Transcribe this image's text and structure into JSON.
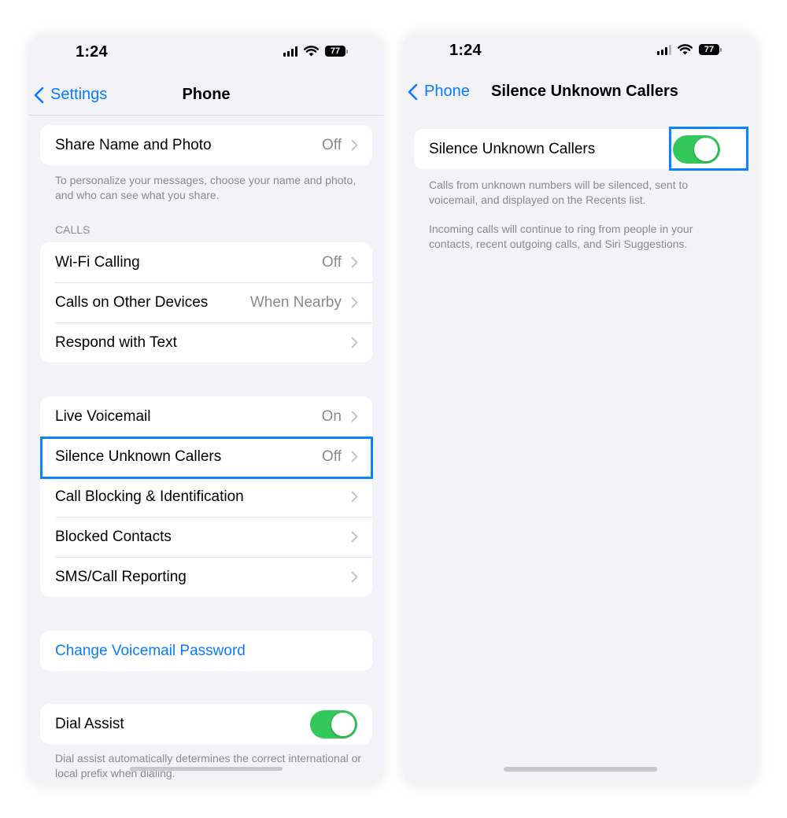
{
  "status": {
    "time": "1:24",
    "battery": "77"
  },
  "left": {
    "back_label": "Settings",
    "title": "Phone",
    "share_row": {
      "label": "Share Name and Photo",
      "value": "Off"
    },
    "share_footnote": "To personalize your messages, choose your name and photo, and who can see what you share.",
    "calls_header": "CALLS",
    "calls_rows": [
      {
        "label": "Wi-Fi Calling",
        "value": "Off"
      },
      {
        "label": "Calls on Other Devices",
        "value": "When Nearby"
      },
      {
        "label": "Respond with Text",
        "value": ""
      }
    ],
    "voicemail_rows": [
      {
        "label": "Live Voicemail",
        "value": "On"
      },
      {
        "label": "Silence Unknown Callers",
        "value": "Off"
      },
      {
        "label": "Call Blocking & Identification",
        "value": ""
      },
      {
        "label": "Blocked Contacts",
        "value": ""
      },
      {
        "label": "SMS/Call Reporting",
        "value": ""
      }
    ],
    "change_voicemail_password": "Change Voicemail Password",
    "dial_assist": {
      "label": "Dial Assist",
      "on": true
    },
    "dial_assist_footnote": "Dial assist automatically determines the correct international or local prefix when dialing."
  },
  "right": {
    "back_label": "Phone",
    "title": "Silence Unknown Callers",
    "toggle_row": {
      "label": "Silence Unknown Callers",
      "on": true
    },
    "footnote_1": "Calls from unknown numbers will be silenced, sent to voicemail, and displayed on the Recents list.",
    "footnote_2": "Incoming calls will continue to ring from people in your contacts, recent outgoing calls, and Siri Suggestions."
  },
  "colors": {
    "accent": "#0a7aff",
    "toggle_on": "#34c759",
    "highlight": "#0a84ff",
    "background": "#f2f2f7"
  }
}
